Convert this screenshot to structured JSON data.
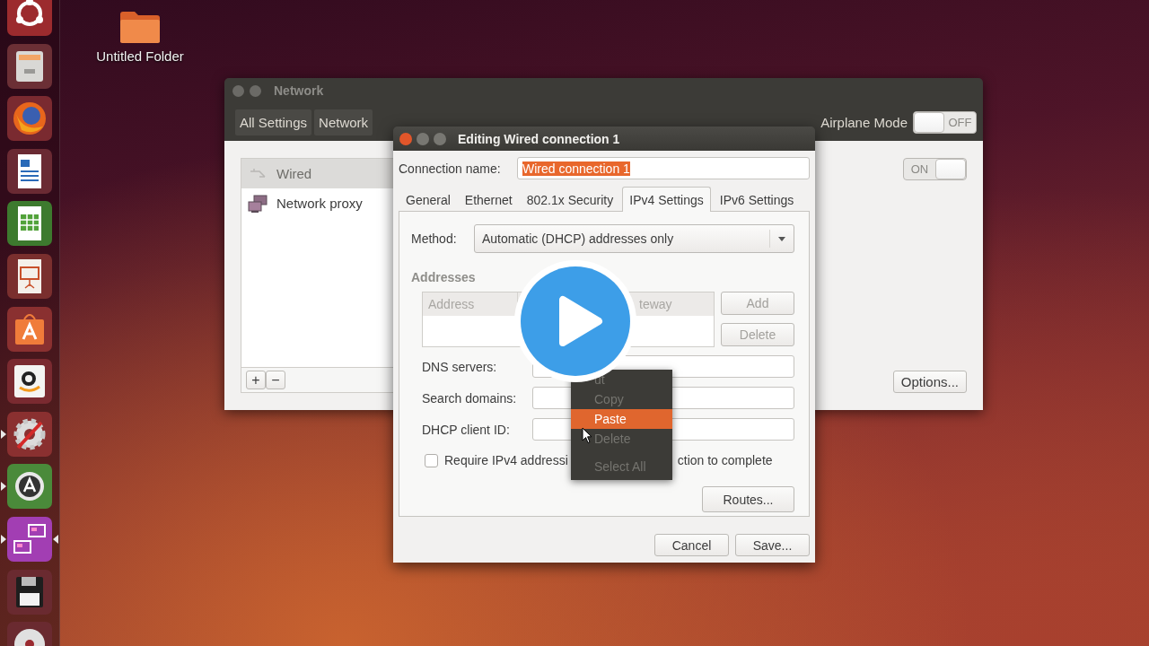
{
  "launcher": {
    "items": [
      {
        "kind": "dash",
        "running": false,
        "focused": false
      },
      {
        "kind": "files",
        "running": false,
        "focused": false
      },
      {
        "kind": "firefox",
        "running": false,
        "focused": false
      },
      {
        "kind": "writer",
        "running": false,
        "focused": false
      },
      {
        "kind": "calc",
        "running": false,
        "focused": false
      },
      {
        "kind": "impress",
        "running": false,
        "focused": false
      },
      {
        "kind": "software",
        "running": false,
        "focused": false
      },
      {
        "kind": "amazon",
        "running": false,
        "focused": false
      },
      {
        "kind": "settings",
        "running": true,
        "focused": false
      },
      {
        "kind": "updater",
        "running": true,
        "focused": false
      },
      {
        "kind": "workspaces",
        "running": true,
        "focused": true
      },
      {
        "kind": "floppy",
        "running": false,
        "focused": false
      },
      {
        "kind": "disc",
        "running": false,
        "focused": false
      }
    ]
  },
  "desktop_icons": [
    {
      "label": "Untitled Folder"
    }
  ],
  "network_window": {
    "title": "Network",
    "breadcrumbs": [
      "All Settings",
      "Network"
    ],
    "airplane_mode": {
      "label": "Airplane Mode",
      "state_text": "OFF",
      "on": false
    },
    "devices": [
      {
        "label": "Wired",
        "selected": true,
        "kind": "wired"
      },
      {
        "label": "Network proxy",
        "selected": false,
        "kind": "proxy"
      }
    ],
    "list_buttons": [
      "+",
      "−"
    ],
    "wired_switch": {
      "state_text": "ON",
      "on": true
    },
    "options_button": "Options..."
  },
  "dialog": {
    "title": "Editing Wired connection 1",
    "connection_name": {
      "label": "Connection name:",
      "value": "Wired connection 1",
      "text_selected": true
    },
    "tabs": [
      {
        "label": "General",
        "selected": false
      },
      {
        "label": "Ethernet",
        "selected": false
      },
      {
        "label": "802.1x Security",
        "selected": false
      },
      {
        "label": "IPv4 Settings",
        "selected": true
      },
      {
        "label": "IPv6 Settings",
        "selected": false
      }
    ],
    "method": {
      "label": "Method:",
      "value": "Automatic (DHCP) addresses only"
    },
    "addresses": {
      "label": "Addresses",
      "columns": [
        "Address",
        "teway"
      ],
      "buttons": [
        {
          "label": "Add",
          "disabled": true
        },
        {
          "label": "Delete",
          "disabled": true
        }
      ]
    },
    "fields": [
      {
        "label": "DNS servers:"
      },
      {
        "label": "Search domains:"
      },
      {
        "label": "DHCP client ID:"
      }
    ],
    "require_checkbox": {
      "label_start": "Require IPv4 addressi",
      "label_end": "ction to complete",
      "checked": false
    },
    "routes_button": "Routes...",
    "buttons": [
      "Cancel",
      "Save..."
    ]
  },
  "context_menu": {
    "items": [
      {
        "kind": "item",
        "label": "ut",
        "disabled": true,
        "selected": false
      },
      {
        "kind": "item",
        "label": "Copy",
        "disabled": true,
        "selected": false
      },
      {
        "kind": "item",
        "label": "Paste",
        "disabled": false,
        "selected": true
      },
      {
        "kind": "item",
        "label": "Delete",
        "disabled": true,
        "selected": false
      },
      {
        "kind": "separator"
      },
      {
        "kind": "item",
        "label": "Select All",
        "disabled": true,
        "selected": false
      }
    ]
  }
}
